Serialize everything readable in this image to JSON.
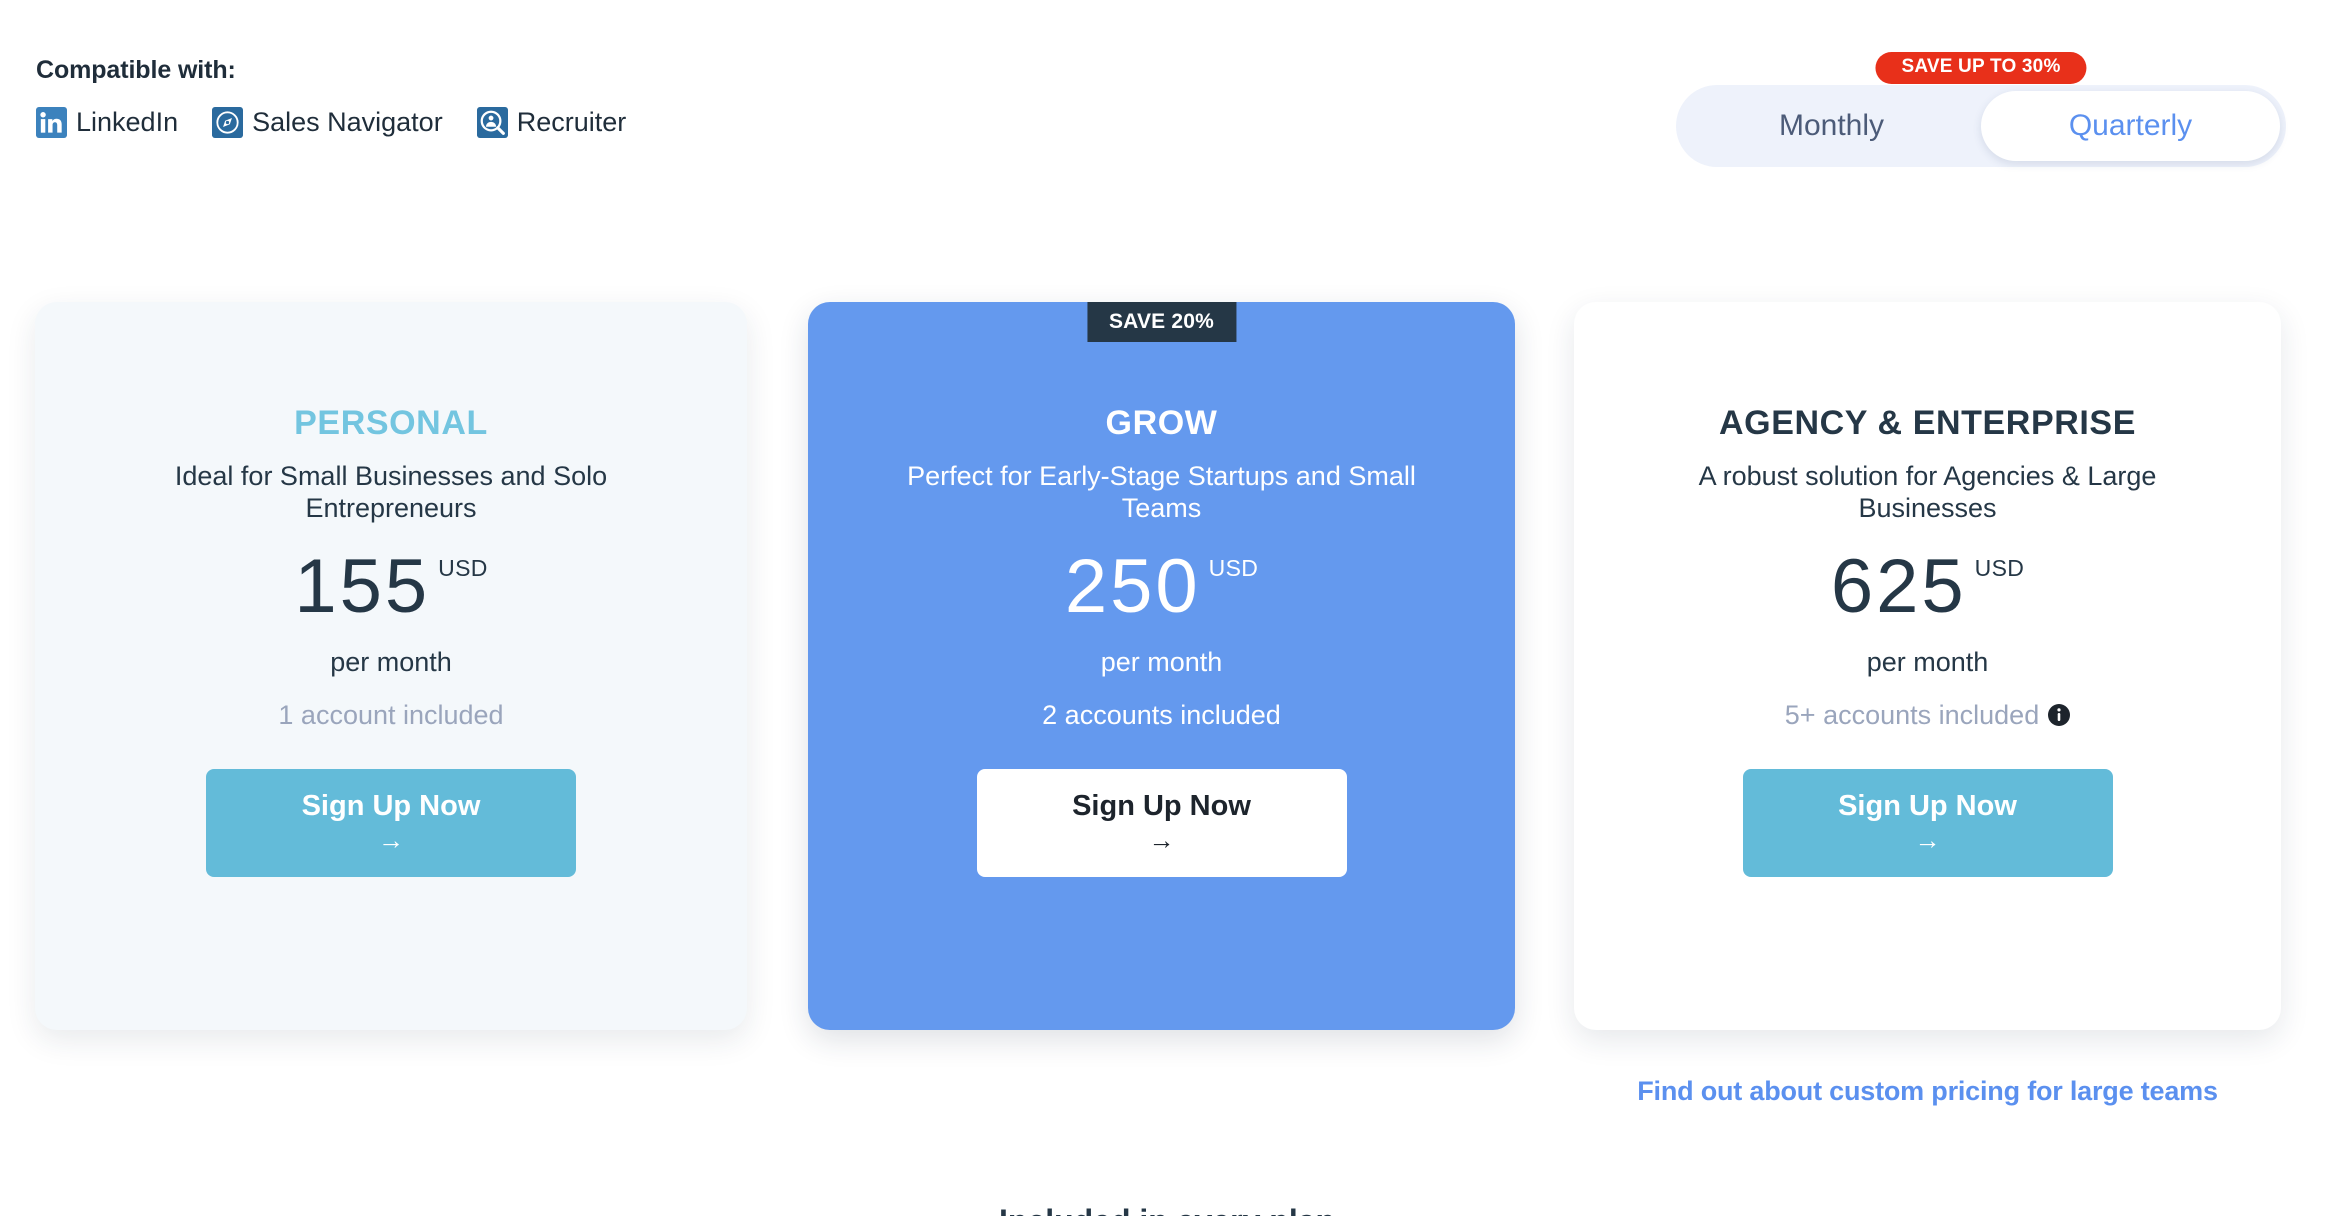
{
  "compatibility": {
    "title": "Compatible with:",
    "items": [
      {
        "label": "LinkedIn",
        "icon": "linkedin-icon"
      },
      {
        "label": "Sales Navigator",
        "icon": "sales-navigator-icon"
      },
      {
        "label": "Recruiter",
        "icon": "recruiter-icon"
      }
    ]
  },
  "billing": {
    "save_badge": "SAVE UP TO 30%",
    "badge_color": "#e8301a",
    "options": [
      {
        "label": "Monthly",
        "active": false
      },
      {
        "label": "Quarterly",
        "active": true
      }
    ],
    "selected": "Quarterly",
    "active_color": "#5b90ef"
  },
  "plans": [
    {
      "name": "PERSONAL",
      "name_color": "#73c5e0",
      "description": "Ideal for Small Businesses and Solo Entrepreneurs",
      "price": "155",
      "currency": "USD",
      "period": "per month",
      "accounts": "1 account included",
      "has_info_icon": false,
      "ribbon": null,
      "cta_label": "Sign Up Now",
      "cta_arrow": "→",
      "background": "#f4f8fb",
      "highlight": false
    },
    {
      "name": "GROW",
      "name_color": "#ffffff",
      "description": "Perfect for Early-Stage Startups and Small Teams",
      "price": "250",
      "currency": "USD",
      "period": "per month",
      "accounts": "2 accounts included",
      "has_info_icon": false,
      "ribbon": "SAVE 20%",
      "cta_label": "Sign Up Now",
      "cta_arrow": "→",
      "background": "#6499ee",
      "highlight": true
    },
    {
      "name": "AGENCY & ENTERPRISE",
      "name_color": "#253746",
      "description": "A robust solution for Agencies & Large Businesses",
      "price": "625",
      "currency": "USD",
      "period": "per month",
      "accounts": "5+ accounts included",
      "has_info_icon": true,
      "ribbon": null,
      "cta_label": "Sign Up Now",
      "cta_arrow": "→",
      "background": "#ffffff",
      "highlight": false
    }
  ],
  "custom_pricing_link": "Find out about custom pricing for large teams",
  "footer_peek": "Included in every plan"
}
